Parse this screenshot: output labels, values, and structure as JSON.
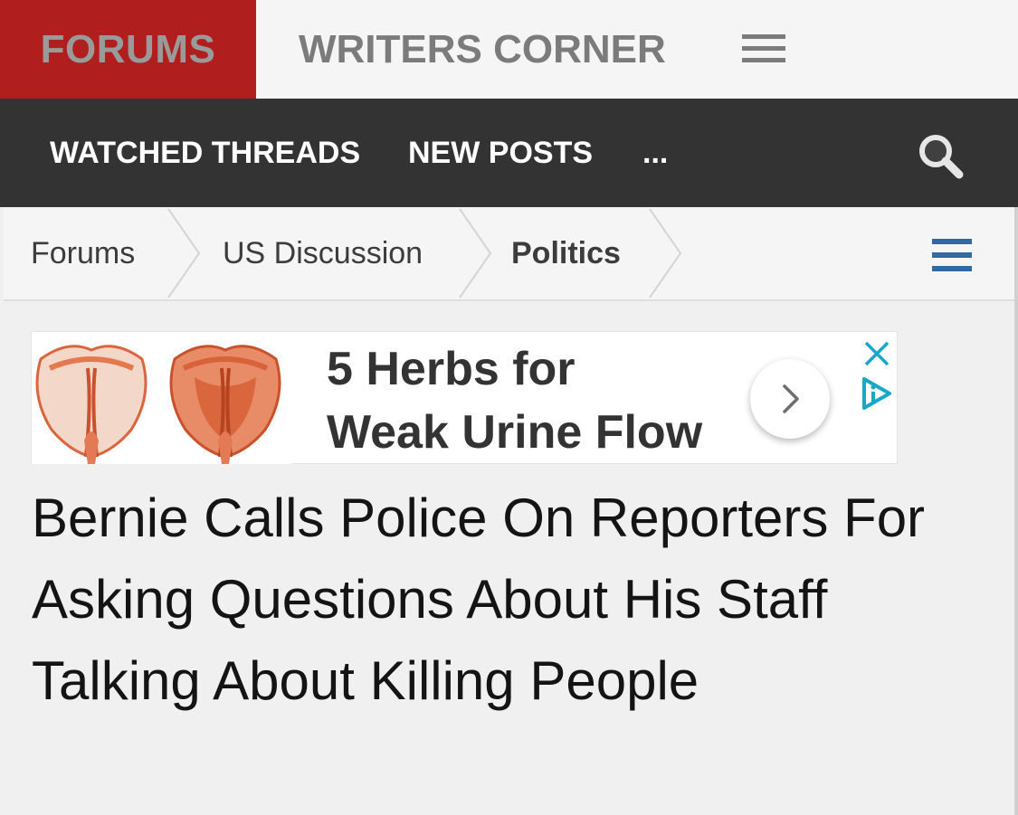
{
  "header": {
    "tabs": [
      {
        "label": "FORUMS",
        "active": true
      },
      {
        "label": "WRITERS CORNER",
        "active": false
      }
    ],
    "menu_icon": "hamburger-menu-icon",
    "active_color": "#b01e1e"
  },
  "nav": {
    "items": [
      {
        "label": "WATCHED THREADS"
      },
      {
        "label": "NEW POSTS"
      },
      {
        "label": "..."
      }
    ],
    "search_icon": "search-icon",
    "background": "#333333"
  },
  "breadcrumb": {
    "items": [
      {
        "label": "Forums"
      },
      {
        "label": "US Discussion"
      },
      {
        "label": "Politics"
      }
    ],
    "menu_icon": "hamburger-menu-icon",
    "menu_color": "#2f6aa3"
  },
  "ad": {
    "headline_line1": "5 Herbs for",
    "headline_line2": "Weak Urine Flow",
    "arrow_icon": "chevron-right-icon",
    "close_icon": "close-icon",
    "adchoices_icon": "adchoices-icon",
    "accent_color": "#17a8c9"
  },
  "thread": {
    "title": "Bernie Calls Police On Reporters For Asking Questions About His Staff Talking About Killing People"
  }
}
